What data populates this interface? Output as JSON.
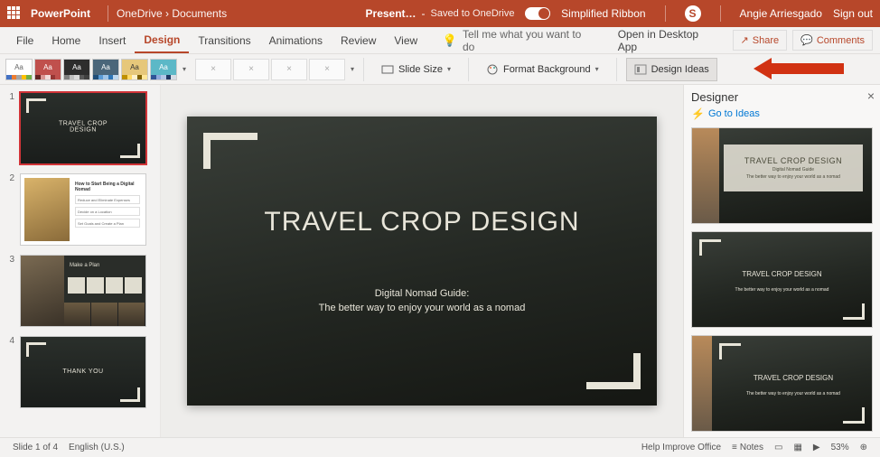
{
  "titlebar": {
    "app": "PowerPoint",
    "crumb1": "OneDrive",
    "crumb2": "Documents",
    "docname": "Present…",
    "saved": "Saved to OneDrive",
    "simplified": "Simplified Ribbon",
    "user": "Angie Arriesgado",
    "signout": "Sign out"
  },
  "menu": {
    "file": "File",
    "home": "Home",
    "insert": "Insert",
    "design": "Design",
    "transitions": "Transitions",
    "animations": "Animations",
    "review": "Review",
    "view": "View",
    "search": "Tell me what you want to do",
    "desktop": "Open in Desktop App",
    "share": "Share",
    "comments": "Comments"
  },
  "ribbon": {
    "slidesize": "Slide Size",
    "formatbg": "Format Background",
    "ideas": "Design Ideas"
  },
  "thumbs": {
    "t1_title": "TRAVEL CROP\nDESIGN",
    "t2_title": "How to Start Being a Digital Nomad",
    "t2_r1": "Reduce and Eliminate Expenses",
    "t2_r2": "Decide on a Location",
    "t2_r3": "Set Goals and Create a Plan",
    "t3_title": "Make a Plan",
    "t4_title": "THANK YOU"
  },
  "slide": {
    "title": "TRAVEL CROP DESIGN",
    "sub1": "Digital Nomad Guide:",
    "sub2": "The better way to enjoy your world as a nomad"
  },
  "designer": {
    "title": "Designer",
    "goto": "Go to Ideas",
    "item_title": "TRAVEL CROP DESIGN",
    "item_sub1": "Digital Nomad Guide",
    "item_sub2": "The better way to enjoy your world as a nomad"
  },
  "status": {
    "slide": "Slide 1 of 4",
    "lang": "English (U.S.)",
    "help": "Help Improve Office",
    "notes": "Notes",
    "zoom": "53%"
  }
}
